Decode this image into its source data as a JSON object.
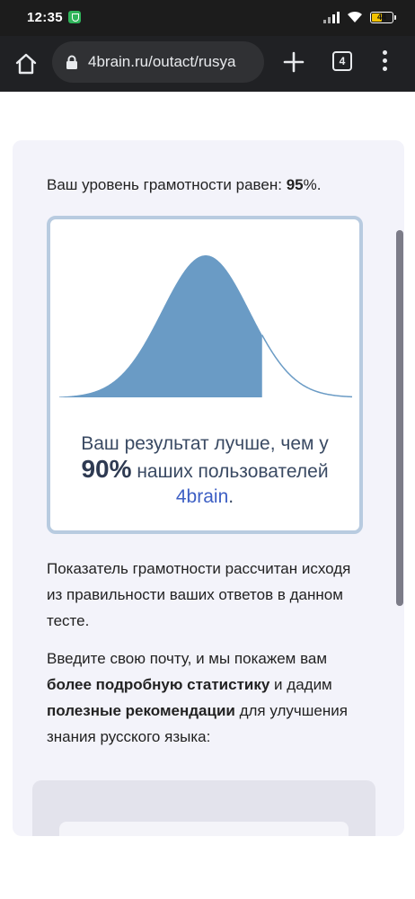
{
  "status_bar": {
    "time": "12:35",
    "battery": "44"
  },
  "browser": {
    "url": "4brain.ru/outact/rusya",
    "tab_count": "4"
  },
  "content": {
    "level_prefix": "Ваш уровень грамотности равен: ",
    "level_value": "95",
    "level_suffix": "%.",
    "result_line1": "Ваш результат лучше, чем у",
    "result_percent": "90%",
    "result_line2": " наших пользователей",
    "result_brand": "4brain",
    "result_end": ".",
    "para1": "Показатель грамотности рассчитан исходя из правильности ваших ответов в данном тесте.",
    "para2_a": "Введите свою почту, и мы покажем вам ",
    "para2_b": "более подробную статистику",
    "para2_c": " и дадим ",
    "para2_d": "полезные рекомендации",
    "para2_e": " для улучшения знания русского языка:"
  },
  "distribution": {
    "percentile_marker": 0.9,
    "fill_color": "#6a9bc5",
    "line_color": "#6a9bc5"
  }
}
